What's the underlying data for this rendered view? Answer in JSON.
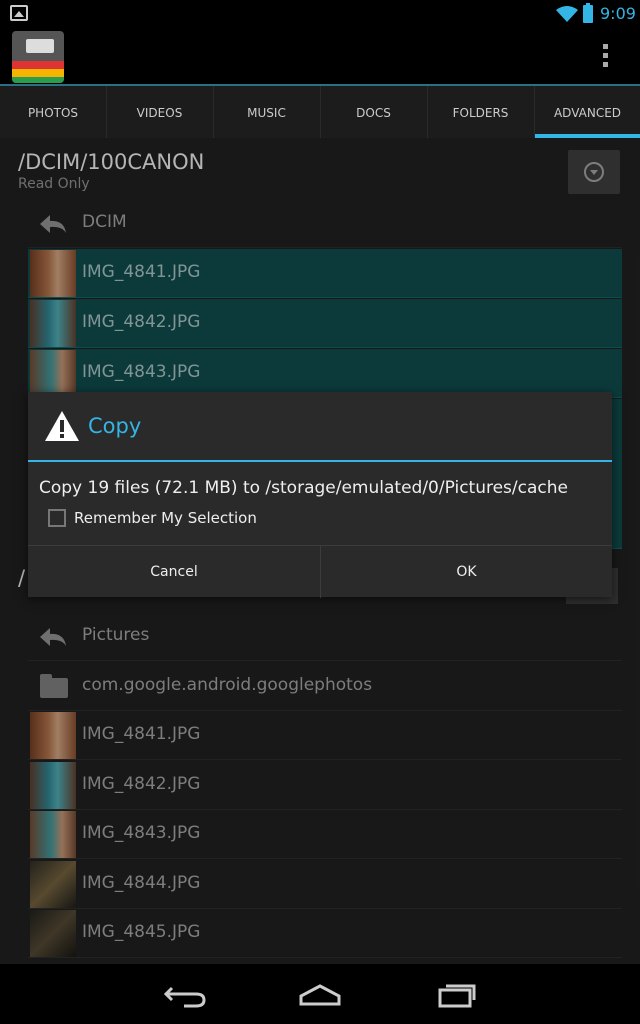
{
  "status_bar": {
    "time": "9:09"
  },
  "tabs": [
    {
      "label": "PHOTOS",
      "active": false
    },
    {
      "label": "VIDEOS",
      "active": false
    },
    {
      "label": "MUSIC",
      "active": false
    },
    {
      "label": "DOCS",
      "active": false
    },
    {
      "label": "FOLDERS",
      "active": false
    },
    {
      "label": "ADVANCED",
      "active": true
    }
  ],
  "top_pane": {
    "path": "/DCIM/100CANON",
    "subtitle": "Read Only",
    "up_label": "DCIM",
    "files": [
      "IMG_4841.JPG",
      "IMG_4842.JPG",
      "IMG_4843.JPG"
    ]
  },
  "bottom_pane": {
    "path_visible": "/",
    "up_label": "Pictures",
    "folder": "com.google.android.googlephotos",
    "files": [
      "IMG_4841.JPG",
      "IMG_4842.JPG",
      "IMG_4843.JPG",
      "IMG_4844.JPG",
      "IMG_4845.JPG"
    ]
  },
  "dialog": {
    "title": "Copy",
    "message": "Copy 19 files (72.1 MB) to /storage/emulated/0/Pictures/cache",
    "checkbox_label": "Remember My Selection",
    "checkbox_checked": false,
    "cancel_label": "Cancel",
    "ok_label": "OK"
  },
  "colors": {
    "accent": "#33b5e5",
    "selection": "#0f4748"
  }
}
